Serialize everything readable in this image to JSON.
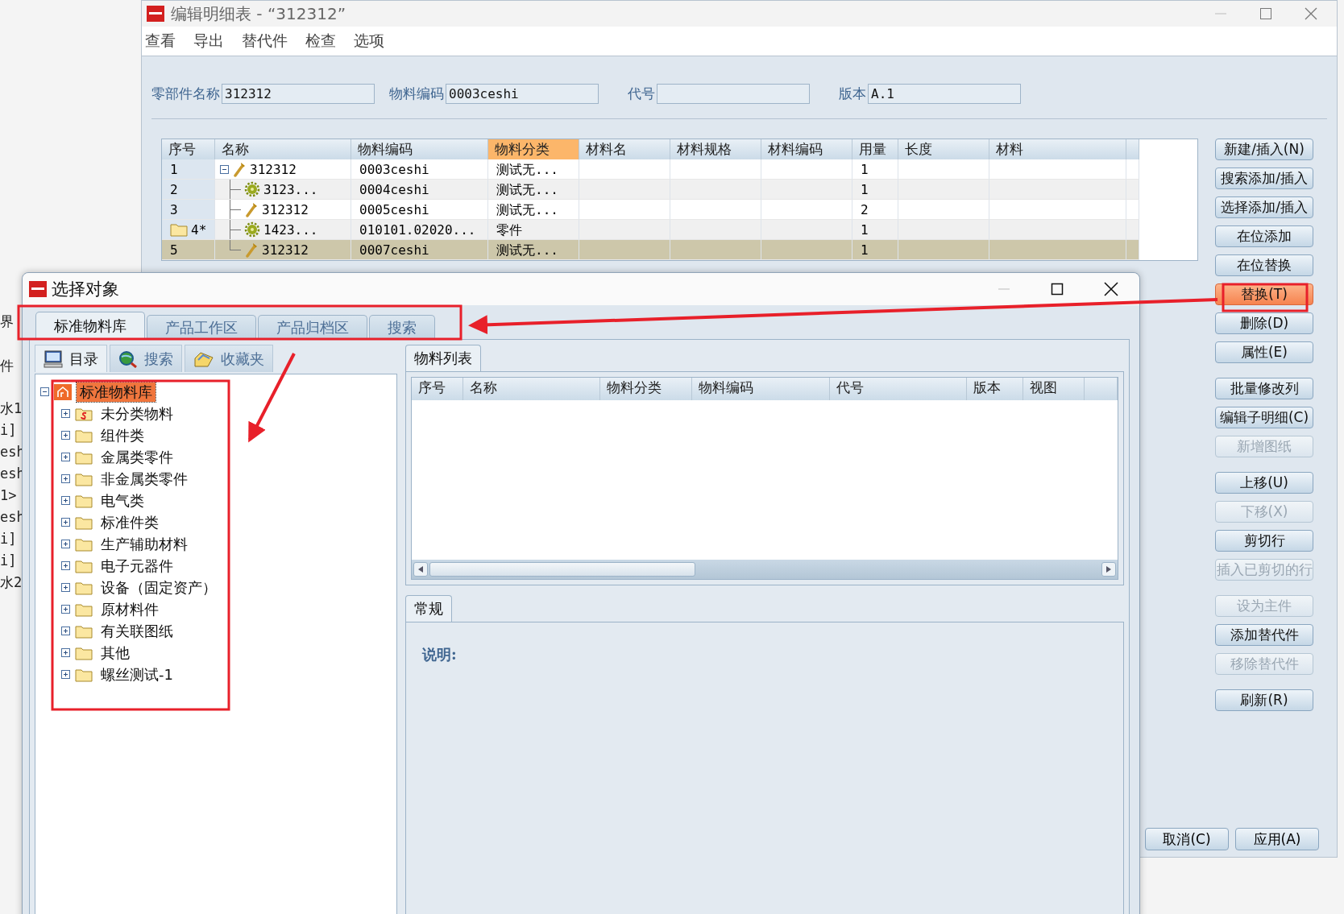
{
  "background_fragments": [
    [
      "界",
      "件"
    ],
    [
      "水1",
      "i]",
      "esh",
      "esh",
      "1>",
      "esh",
      "i]",
      "i]",
      "水2"
    ]
  ],
  "main_window": {
    "title": "编辑明细表 - “312312”",
    "menu": [
      "查看",
      "导出",
      "替代件",
      "检查",
      "选项"
    ],
    "fields": [
      {
        "label": "零部件名称",
        "value": "312312"
      },
      {
        "label": "物料编码",
        "value": "0003ceshi"
      },
      {
        "label": "代号"
      },
      {
        "label": "版本",
        "value": "A.1"
      }
    ],
    "table": {
      "columns": [
        {
          "label": "序号",
          "selected": false
        },
        {
          "label": "名称",
          "selected": false
        },
        {
          "label": "物料编码",
          "selected": false
        },
        {
          "label": "物料分类",
          "selected": true
        },
        {
          "label": "材料名",
          "selected": false
        },
        {
          "label": "材料规格",
          "selected": false
        },
        {
          "label": "材料编码",
          "selected": false
        },
        {
          "label": "用量",
          "selected": false
        },
        {
          "label": "长度",
          "selected": false
        },
        {
          "label": "材料",
          "selected": false
        },
        {
          "selected": false
        }
      ],
      "rows": [
        {
          "no": "1",
          "name": "312312",
          "kind": "part",
          "folder": false,
          "selected": false,
          "expanded": true,
          "code": "0003ceshi",
          "category": "测试无...",
          "qty": "1",
          "children": [
            {
              "no": "2",
              "name": "3123...",
              "kind": "assembly",
              "folder": false,
              "selected": false,
              "code": "0004ceshi",
              "category": "测试无...",
              "qty": "1"
            },
            {
              "no": "3",
              "name": "312312",
              "kind": "part",
              "folder": false,
              "selected": false,
              "code": "0005ceshi",
              "category": "测试无...",
              "qty": "2"
            },
            {
              "no": "4*",
              "name": "1423...",
              "kind": "assembly",
              "folder": true,
              "selected": false,
              "code": "010101.02020...",
              "category": "零件",
              "qty": "1"
            },
            {
              "no": "5",
              "name": "312312",
              "kind": "part",
              "folder": false,
              "selected": true,
              "code": "0007ceshi",
              "category": "测试无...",
              "qty": "1"
            }
          ]
        }
      ]
    },
    "button_groups": [
      [
        {
          "label": "新建/插入(N)",
          "disabled": false,
          "highlighted": false
        },
        {
          "label": "搜索添加/插入",
          "disabled": false,
          "highlighted": false
        },
        {
          "label": "选择添加/插入",
          "disabled": false,
          "highlighted": false
        },
        {
          "label": "在位添加",
          "disabled": false,
          "highlighted": false
        },
        {
          "label": "在位替换",
          "disabled": false,
          "highlighted": false
        },
        {
          "label": "替换(T)",
          "disabled": false,
          "highlighted": true
        },
        {
          "label": "删除(D)",
          "disabled": false,
          "highlighted": false
        },
        {
          "label": "属性(E)",
          "disabled": false,
          "highlighted": false
        }
      ],
      [
        {
          "label": "批量修改列",
          "disabled": false,
          "highlighted": false
        },
        {
          "label": "编辑子明细(C)",
          "disabled": false,
          "highlighted": false
        },
        {
          "label": "新增图纸",
          "disabled": true,
          "highlighted": false
        }
      ],
      [
        {
          "label": "上移(U)",
          "disabled": false,
          "highlighted": false
        },
        {
          "label": "下移(X)",
          "disabled": true,
          "highlighted": false
        },
        {
          "label": "剪切行",
          "disabled": false,
          "highlighted": false
        },
        {
          "label": "插入已剪切的行",
          "disabled": true,
          "highlighted": false
        }
      ],
      [
        {
          "label": "设为主件",
          "disabled": true,
          "highlighted": false
        },
        {
          "label": "添加替代件",
          "disabled": false,
          "highlighted": false
        },
        {
          "label": "移除替代件",
          "disabled": true,
          "highlighted": false
        }
      ],
      [
        {
          "label": "刷新(R)",
          "disabled": false,
          "highlighted": false
        }
      ]
    ],
    "footer_buttons": [
      "取消(C)",
      "应用(A)"
    ]
  },
  "dialog": {
    "title": "选择对象",
    "tabs": [
      {
        "label": "标准物料库",
        "selected": true
      },
      {
        "label": "产品工作区",
        "selected": false
      },
      {
        "label": "产品归档区",
        "selected": false
      },
      {
        "label": "搜索",
        "selected": false
      }
    ],
    "subtabs": [
      {
        "label": "目录",
        "kind": "catalog",
        "selected": true
      },
      {
        "label": "搜索",
        "kind": "search",
        "selected": false
      },
      {
        "label": "收藏夹",
        "kind": "favorites",
        "selected": false
      }
    ],
    "tree": [
      {
        "label": "标准物料库",
        "kind": "library",
        "expanded": true,
        "selected": true,
        "children": [
          {
            "label": "未分类物料",
            "kind": "unclassified",
            "expanded": false,
            "selected": false
          },
          {
            "label": "组件类",
            "kind": "folder",
            "expanded": false,
            "selected": false
          },
          {
            "label": "金属类零件",
            "kind": "folder",
            "expanded": false,
            "selected": false
          },
          {
            "label": "非金属类零件",
            "kind": "folder",
            "expanded": false,
            "selected": false
          },
          {
            "label": "电气类",
            "kind": "folder",
            "expanded": false,
            "selected": false
          },
          {
            "label": "标准件类",
            "kind": "folder",
            "expanded": false,
            "selected": false
          },
          {
            "label": "生产辅助材料",
            "kind": "folder",
            "expanded": false,
            "selected": false
          },
          {
            "label": "电子元器件",
            "kind": "folder",
            "expanded": false,
            "selected": false
          },
          {
            "label": "设备（固定资产）",
            "kind": "folder",
            "expanded": false,
            "selected": false
          },
          {
            "label": "原材料件",
            "kind": "folder",
            "expanded": false,
            "selected": false
          },
          {
            "label": "有关联图纸",
            "kind": "folder",
            "expanded": false,
            "selected": false
          },
          {
            "label": "其他",
            "kind": "folder",
            "expanded": false,
            "selected": false
          },
          {
            "label": "螺丝测试-1",
            "kind": "folder",
            "expanded": false,
            "selected": false
          }
        ]
      }
    ],
    "list_tab": "物料列表",
    "list_columns": [
      "序号",
      "名称",
      "物料分类",
      "物料编码",
      "代号",
      "版本",
      "视图"
    ],
    "detail_tab": "常规",
    "detail_label": "说明:"
  }
}
